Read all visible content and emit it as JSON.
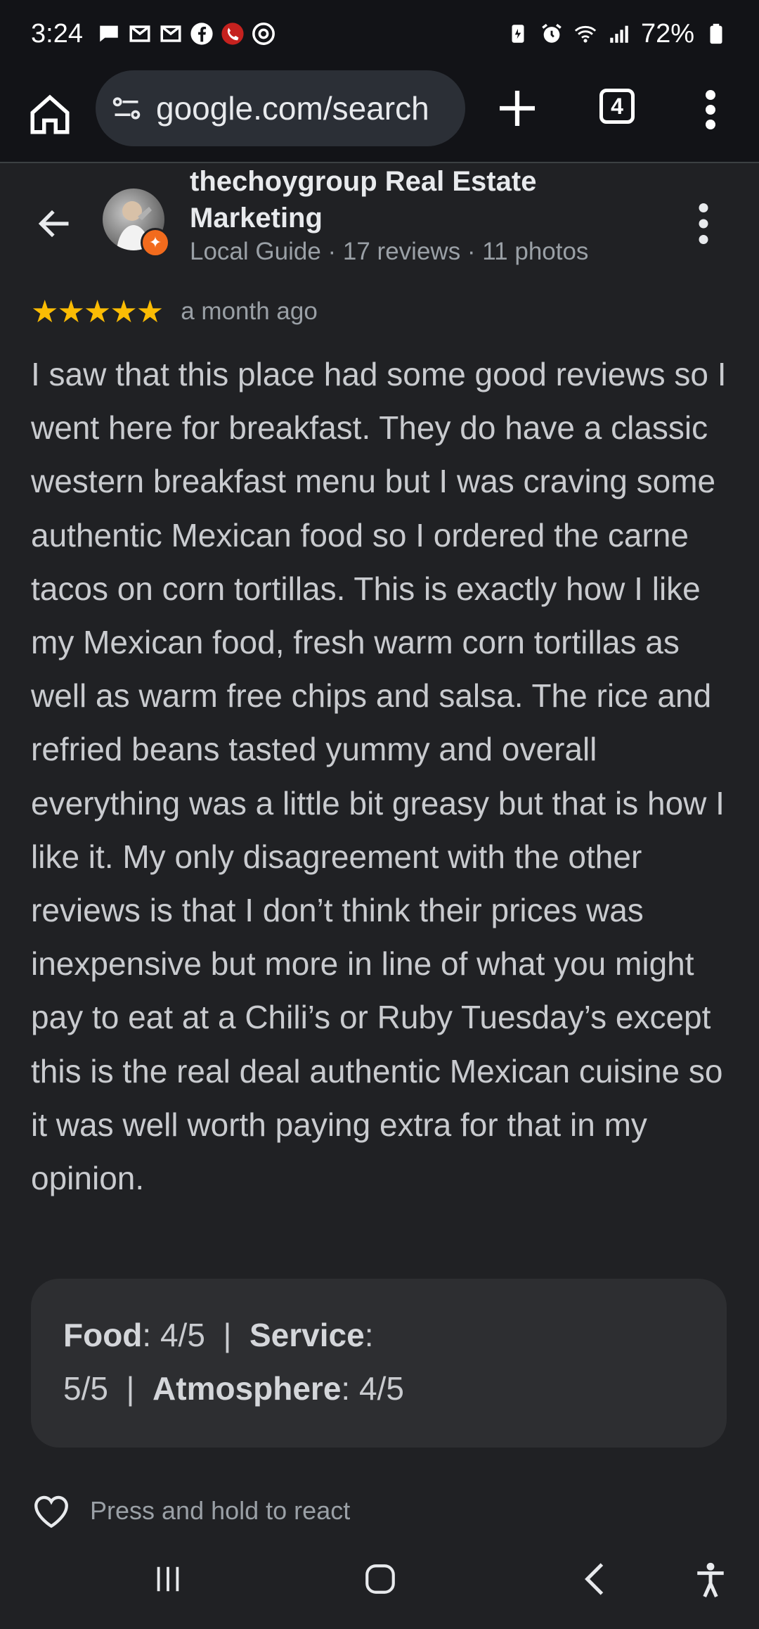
{
  "status_bar": {
    "time": "3:24",
    "battery": "72%"
  },
  "browser": {
    "url": "google.com/search",
    "tab_count": "4"
  },
  "reviewer": {
    "name": "thechoygroup Real Estate Marketing",
    "meta": "Local Guide · 17 reviews · 11 photos"
  },
  "review": {
    "stars": "★★★★★",
    "rating_value": 5,
    "time_ago": "a month ago",
    "text": "I saw that this place had some good reviews so I went here for breakfast. They do have a classic western breakfast menu but I was craving some authentic Mexican food so I ordered the carne tacos on corn tortillas. This is exactly how I like my Mexican food, fresh warm corn tortillas as well as warm free chips and salsa. The rice and refried beans tasted yummy and overall everything was a little bit greasy but that is how I like it. My only disagreement with the other reviews is that I don’t think their prices was inexpensive but more in line of what you might pay to eat at a Chili’s or Ruby Tuesday’s except this is the real deal authentic Mexican cuisine so it was well worth paying extra for that in my opinion."
  },
  "scores": {
    "food_label": "Food",
    "food_value": ": 4/5",
    "sep1": "  |  ",
    "service_label": "Service",
    "service_value": ": 5/5",
    "sep2": "  |  ",
    "atmosphere_label": "Atmosphere",
    "atmosphere_value": ": 4/5"
  },
  "react": {
    "label": "Press and hold to react"
  },
  "icons": {
    "accent_star": "#fbbc04",
    "badge_color": "#f26b1d"
  }
}
